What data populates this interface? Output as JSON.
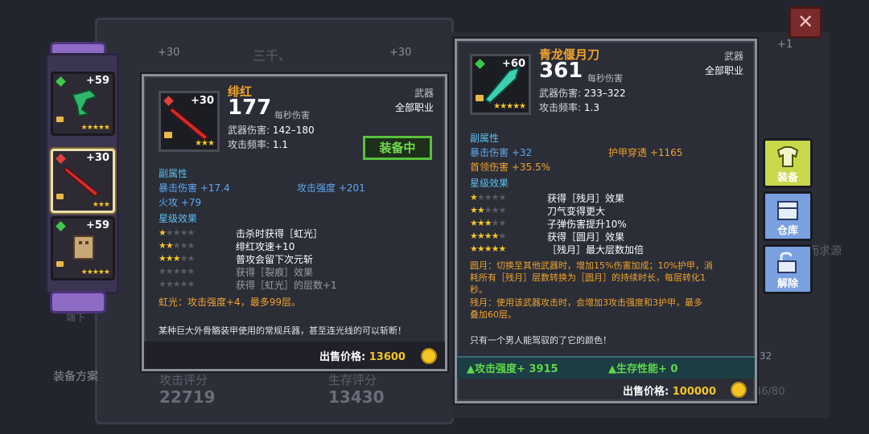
{
  "background": {
    "header_title": "三千、",
    "plus_left": "+30",
    "plus_right": "+30",
    "plus_far": "+1",
    "attack_label": "攻击评分",
    "attack_value": "22719",
    "survive_label": "生存评分",
    "survive_value": "13430",
    "plan_label": "装备方案",
    "slot_count": "46/80",
    "right_count": "32",
    "side_text": "而求源",
    "small_text": "端下"
  },
  "close_label": "✕",
  "left_slots": [
    {
      "level": "+59",
      "stars": "★★★★★",
      "gem": "#3fc84a"
    },
    {
      "level": "+30",
      "stars": "★★★",
      "gem": "#e04040"
    },
    {
      "level": "+59",
      "stars": "★★★★★",
      "gem": "#3fc84a"
    }
  ],
  "equipped": {
    "name": "绯红",
    "level": "+30",
    "icon_stars": "★★★",
    "dps": "177",
    "dps_label": "每秒伤害",
    "damage_label": "武器伤害:",
    "damage": "142–180",
    "rate_label": "攻击频率:",
    "rate": "1.1",
    "category": "武器",
    "job": "全部职业",
    "equipped_label": "装备中",
    "sub_title": "副属性",
    "subs": [
      {
        "label": "暴击伤害 +17.4",
        "color": "blue"
      },
      {
        "label": "攻击强度 +201",
        "color": "blue"
      },
      {
        "label": "火攻 +79",
        "color": "blue"
      }
    ],
    "star_title": "星级效果",
    "effects": [
      {
        "stars": 1,
        "text": "击杀时获得［虹光］",
        "active": true
      },
      {
        "stars": 2,
        "text": "绯红攻速+10",
        "active": true
      },
      {
        "stars": 3,
        "text": "普攻会留下次元斩",
        "active": true
      },
      {
        "stars": 4,
        "text": "获得［裂痕］效果",
        "active": false
      },
      {
        "stars": 5,
        "text": "获得［虹光］的层数+1",
        "active": false
      }
    ],
    "note": "虹光：攻击强度+4，最多99层。",
    "flavor": "某种巨大外骨骼装甲使用的常规兵器，甚至连光线的可以斩断！",
    "price_label": "出售价格:",
    "price": "13600"
  },
  "compare": {
    "name": "青龙偃月刀",
    "level": "+60",
    "icon_stars": "★★★★★",
    "dps": "361",
    "dps_label": "每秒伤害",
    "damage_label": "武器伤害:",
    "damage": "233–322",
    "rate_label": "攻击频率:",
    "rate": "1.3",
    "category": "武器",
    "job": "全部职业",
    "sub_title": "副属性",
    "subs": [
      {
        "label": "暴击伤害 +32",
        "color": "blue"
      },
      {
        "label": "护甲穿透 +1165",
        "color": "orange"
      },
      {
        "label": "首领伤害 +35.5%",
        "color": "orange"
      }
    ],
    "star_title": "星级效果",
    "effects": [
      {
        "stars": 1,
        "text": "获得［残月］效果",
        "active": true
      },
      {
        "stars": 2,
        "text": "刀气变得更大",
        "active": true
      },
      {
        "stars": 3,
        "text": "子弹伤害提升10%",
        "active": true
      },
      {
        "stars": 4,
        "text": "获得［圆月］效果",
        "active": true
      },
      {
        "stars": 5,
        "text": "［残月］最大层数加倍",
        "active": true
      }
    ],
    "note1_head": "圆月：",
    "note1_line1": "切换至其他武器时，增加15%伤害加成；10%护甲，消",
    "note1_line2": "耗所有［残月］层数转换为［圆月］的持续时长，每层转化1",
    "note1_line3": "秒。",
    "note2_head": "残月：",
    "note2_line1": "使用该武器攻击时，会增加3攻击强度和3护甲，最多",
    "note2_line2": "叠加60层。",
    "flavor": "只有一个男人能驾驭的了它的颜色！",
    "cmp_attack": "▲攻击强度+ 3915",
    "cmp_survive": "▲生存性能+ 0",
    "price_label": "出售价格:",
    "price": "100000"
  },
  "tabs": [
    {
      "label": "装备",
      "color": "#c8d84a"
    },
    {
      "label": "仓库",
      "color": "#7aa0e0"
    },
    {
      "label": "解除",
      "color": "#7aa0e0"
    }
  ]
}
